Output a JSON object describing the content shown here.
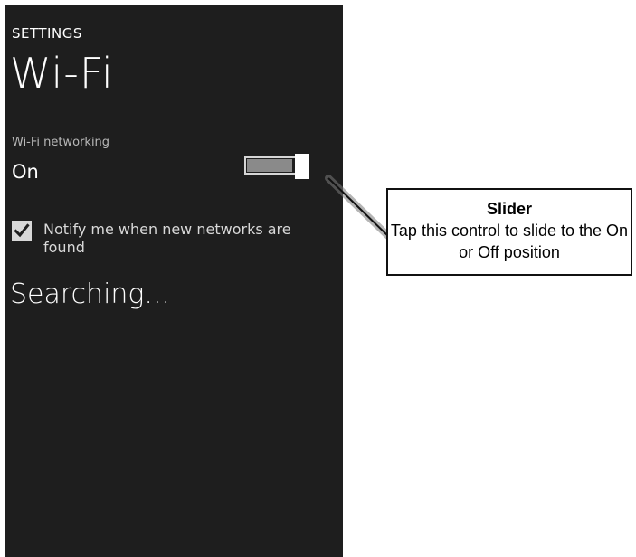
{
  "screen": {
    "app_title": "SETTINGS",
    "page_title": "Wi-Fi",
    "wifi_setting": {
      "label": "Wi-Fi networking",
      "value": "On",
      "toggle_state": "on"
    },
    "notify_checkbox": {
      "checked": true,
      "label": "Notify me when new networks are found"
    },
    "status_text": "Searching..."
  },
  "callout": {
    "title": "Slider",
    "description": "Tap this control to slide to the On or Off position"
  },
  "colors": {
    "phone_background": "#1e1e1e",
    "text": "#ffffff",
    "secondary_text": "#b8b8b8",
    "toggle_fill": "#8a8a8a",
    "toggle_thumb": "#ffffff"
  },
  "icons": {
    "checkbox": "checkmark-icon"
  }
}
